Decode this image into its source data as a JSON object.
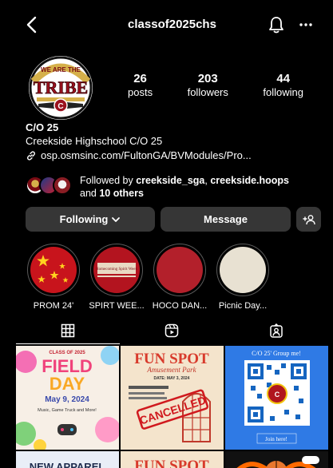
{
  "header": {
    "username": "classof2025chs",
    "back_icon": "chevron-left-icon",
    "notify_icon": "bell-icon",
    "more_icon": "ellipsis-icon"
  },
  "avatar": {
    "text": "WE ARE THE",
    "word": "TRIBE",
    "letter": "C"
  },
  "stats": [
    {
      "value": "26",
      "label": "posts"
    },
    {
      "value": "203",
      "label": "followers"
    },
    {
      "value": "44",
      "label": "following"
    }
  ],
  "profile": {
    "name": "C/O 25",
    "bio": "Creekside Highschool C/O 25",
    "link": "osp.osmsinc.com/FultonGA/BVModules/Pro..."
  },
  "followed_by": {
    "prefix": "Followed by",
    "user1": "creekside_sga",
    "sep": ",",
    "user2": "creekside.hoops",
    "and": "and",
    "others": "10 others"
  },
  "buttons": {
    "following": "Following",
    "message": "Message",
    "add_user_icon": "add-person-icon"
  },
  "highlights": [
    {
      "label": "PROM 24'"
    },
    {
      "label": "SPIRT WEE..."
    },
    {
      "label": "HOCO DAN..."
    },
    {
      "label": "Picnic Day..."
    }
  ],
  "highlight_art": {
    "spirit_small_text": "Homecoming Spirit Week"
  },
  "tabs": {
    "grid_icon": "grid-icon",
    "reels_icon": "reels-icon",
    "tagged_icon": "tagged-person-icon"
  },
  "posts": {
    "p1": {
      "top": "CLASS OF 2025",
      "title1": "FIELD",
      "title2": "DAY",
      "date": "May 9, 2024",
      "sub": "Music, Game Truck and More!"
    },
    "p2": {
      "title1": "FUN SPOT",
      "title2": "Amusement Park",
      "date": "DATE: MAY 3, 2024",
      "stamp": "CANCELLED"
    },
    "p3": {
      "top": "C/O 25' Group me!",
      "bottom": "Join here!"
    },
    "p4": {
      "text": "NEW APPAREL"
    },
    "p5": {
      "title1": "FUN SPOT"
    }
  },
  "colors": {
    "background": "#000000",
    "button_bg": "#363636",
    "text": "#ffffff"
  }
}
